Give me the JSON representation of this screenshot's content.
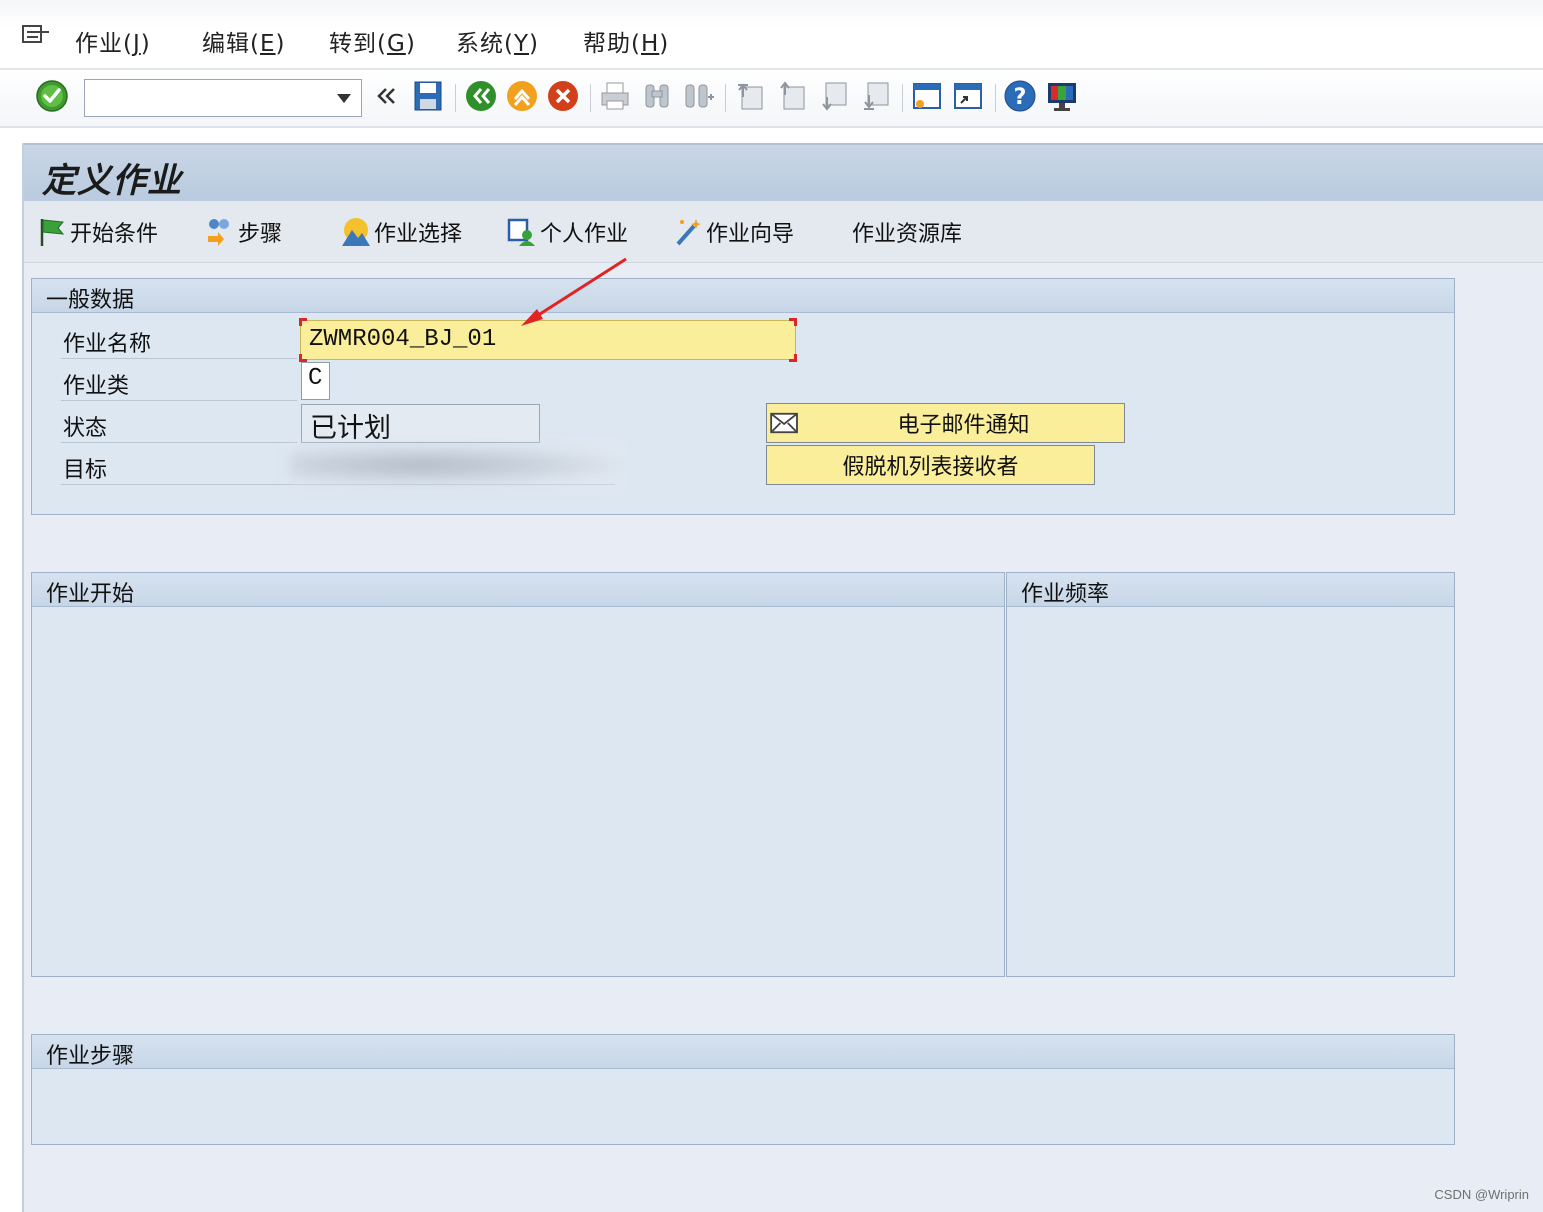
{
  "menu": {
    "items": [
      {
        "text": "作业(",
        "key": "J",
        "end": ")"
      },
      {
        "text": "编辑(",
        "key": "E",
        "end": ")"
      },
      {
        "text": "转到(",
        "key": "G",
        "end": ")"
      },
      {
        "text": "系统(",
        "key": "Y",
        "end": ")"
      },
      {
        "text": "帮助(",
        "key": "H",
        "end": ")"
      }
    ]
  },
  "toolbar": {
    "command_value": "",
    "icons": [
      "enter-icon",
      "back-icon",
      "save-icon",
      "back-green-icon",
      "exit-icon",
      "cancel-icon",
      "print-icon",
      "find-icon",
      "find-next-icon",
      "first-page-icon",
      "previous-page-icon",
      "next-page-icon",
      "last-page-icon",
      "create-session-icon",
      "create-shortcut-icon",
      "help-icon",
      "customize-layout-icon"
    ]
  },
  "page": {
    "title": "定义作业"
  },
  "app_toolbar": {
    "start_condition": "开始条件",
    "step": "步骤",
    "job_selection": "作业选择",
    "own_jobs": "个人作业",
    "job_wizard": "作业向导",
    "job_repository": "作业资源库"
  },
  "general": {
    "title": "一般数据",
    "job_name_label": "作业名称",
    "job_name_value": "ZWMR004_BJ_01",
    "job_class_label": "作业类",
    "job_class_value": "C",
    "status_label": "状态",
    "status_value": "已计划",
    "target_label": "目标",
    "email_button": "电子邮件通知",
    "spool_button": "假脱机列表接收者"
  },
  "job_start": {
    "title": "作业开始"
  },
  "job_frequency": {
    "title": "作业频率"
  },
  "job_steps": {
    "title": "作业步骤"
  },
  "footer": {
    "watermark": "CSDN @Wriprin"
  },
  "colors": {
    "accent_yellow": "#fbee9a",
    "panel_bg": "#dde7f2",
    "arrow_red": "#e02424"
  }
}
